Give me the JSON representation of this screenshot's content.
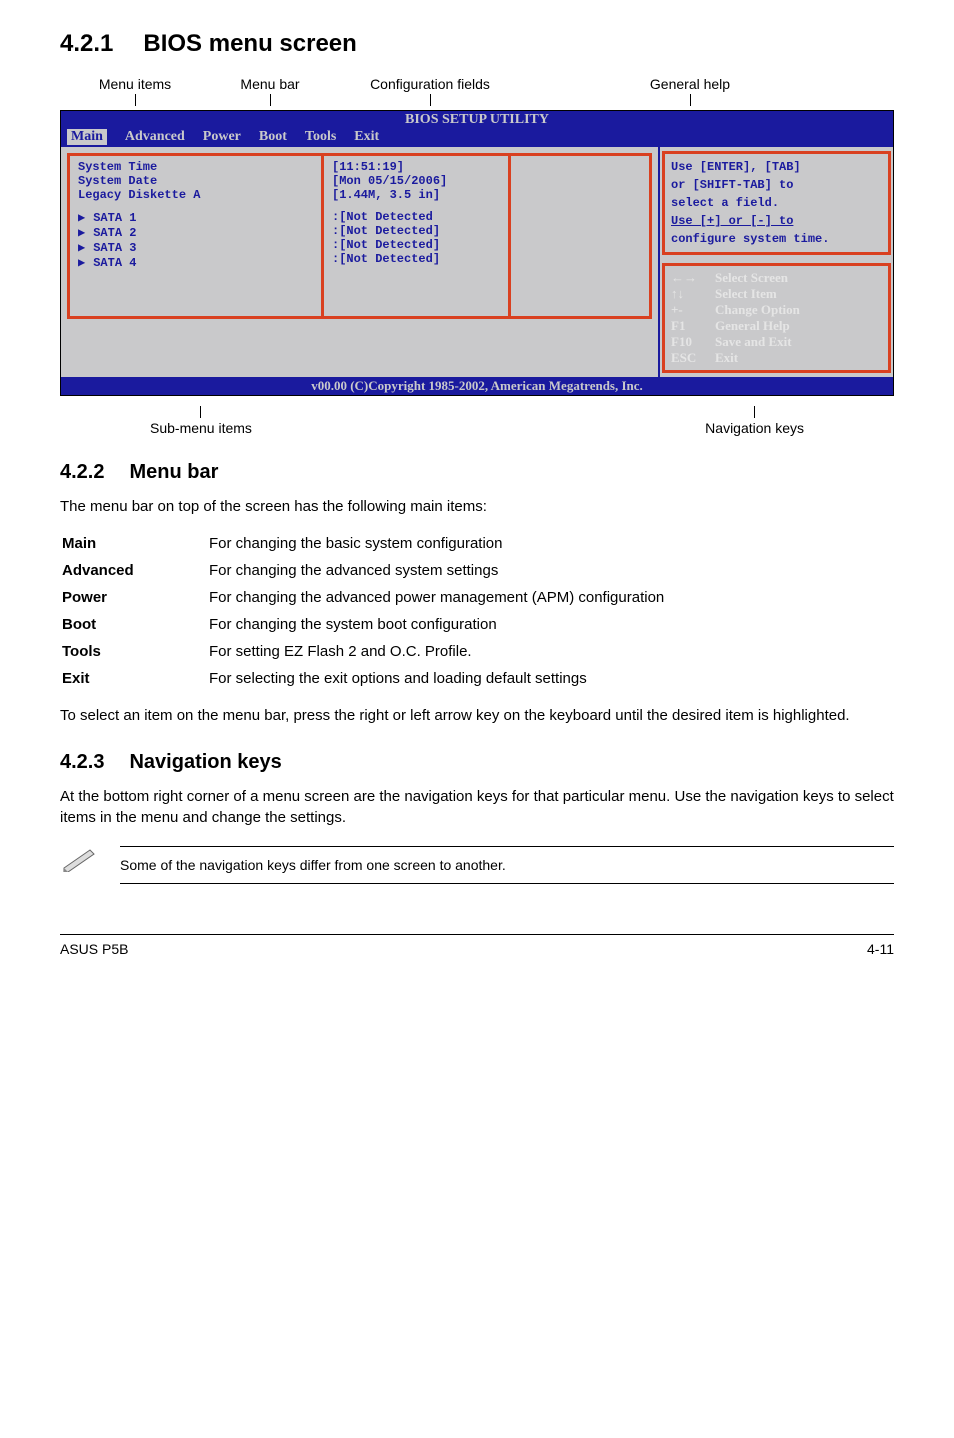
{
  "heading_421": {
    "num": "4.2.1",
    "title": "BIOS menu screen"
  },
  "topLabels": {
    "menuItems": "Menu items",
    "menuBar": "Menu bar",
    "configFields": "Configuration fields",
    "generalHelp": "General help"
  },
  "bios": {
    "header": "BIOS SETUP UTILITY",
    "tabs": [
      "Main",
      "Advanced",
      "Power",
      "Boot",
      "Tools",
      "Exit"
    ],
    "fields": [
      {
        "label": "System Time",
        "value": "[11:51:19]",
        "sub": false
      },
      {
        "label": "System Date",
        "value": "[Mon 05/15/2006]",
        "sub": false
      },
      {
        "label": "Legacy Diskette A",
        "value": "[1.44M, 3.5 in]",
        "sub": false
      },
      {
        "label": "SATA 1",
        "value": ":[Not Detected",
        "sub": true
      },
      {
        "label": "SATA 2",
        "value": ":[Not Detected]",
        "sub": true
      },
      {
        "label": "SATA 3",
        "value": ":[Not Detected]",
        "sub": true
      },
      {
        "label": "SATA 4",
        "value": ":[Not Detected]",
        "sub": true
      }
    ],
    "hint": [
      "Use [ENTER], [TAB]",
      "or [SHIFT-TAB] to",
      "select a field.",
      "Use [+] or [-] to",
      "configure system time."
    ],
    "navKeys": [
      {
        "k": "←→",
        "d": "Select Screen"
      },
      {
        "k": "↑↓",
        "d": "Select Item"
      },
      {
        "k": "+-",
        "d": "Change Option"
      },
      {
        "k": "F1",
        "d": "General Help"
      },
      {
        "k": "F10",
        "d": "Save and Exit"
      },
      {
        "k": "ESC",
        "d": "Exit"
      }
    ],
    "footer": "v00.00 (C)Copyright 1985-2002, American Megatrends, Inc."
  },
  "underLabels": {
    "sub": "Sub-menu items",
    "nav": "Navigation keys"
  },
  "heading_422": {
    "num": "4.2.2",
    "title": "Menu bar"
  },
  "menubar_intro": "The menu bar on top of the screen has the following main items:",
  "defs": [
    {
      "k": "Main",
      "v": "For changing the basic system configuration"
    },
    {
      "k": "Advanced",
      "v": "For changing the advanced system settings"
    },
    {
      "k": "Power",
      "v": "For changing the advanced power management (APM) configuration"
    },
    {
      "k": "Boot",
      "v": "For changing the system boot configuration"
    },
    {
      "k": "Tools",
      "v": "For setting EZ Flash 2 and O.C. Profile."
    },
    {
      "k": "Exit",
      "v": "For selecting the exit options and loading default settings"
    }
  ],
  "menubar_outro": "To select an item on the menu bar, press the right or left arrow key on the keyboard until the desired item is highlighted.",
  "heading_423": {
    "num": "4.2.3",
    "title": "Navigation keys"
  },
  "navkeys_text": "At the bottom right corner of a menu screen are the navigation keys for that particular menu. Use the navigation keys to select items in the menu and change the settings.",
  "note": "Some of the navigation keys differ from one screen to another.",
  "pageFooter": {
    "left": "ASUS P5B",
    "right": "4-11"
  }
}
